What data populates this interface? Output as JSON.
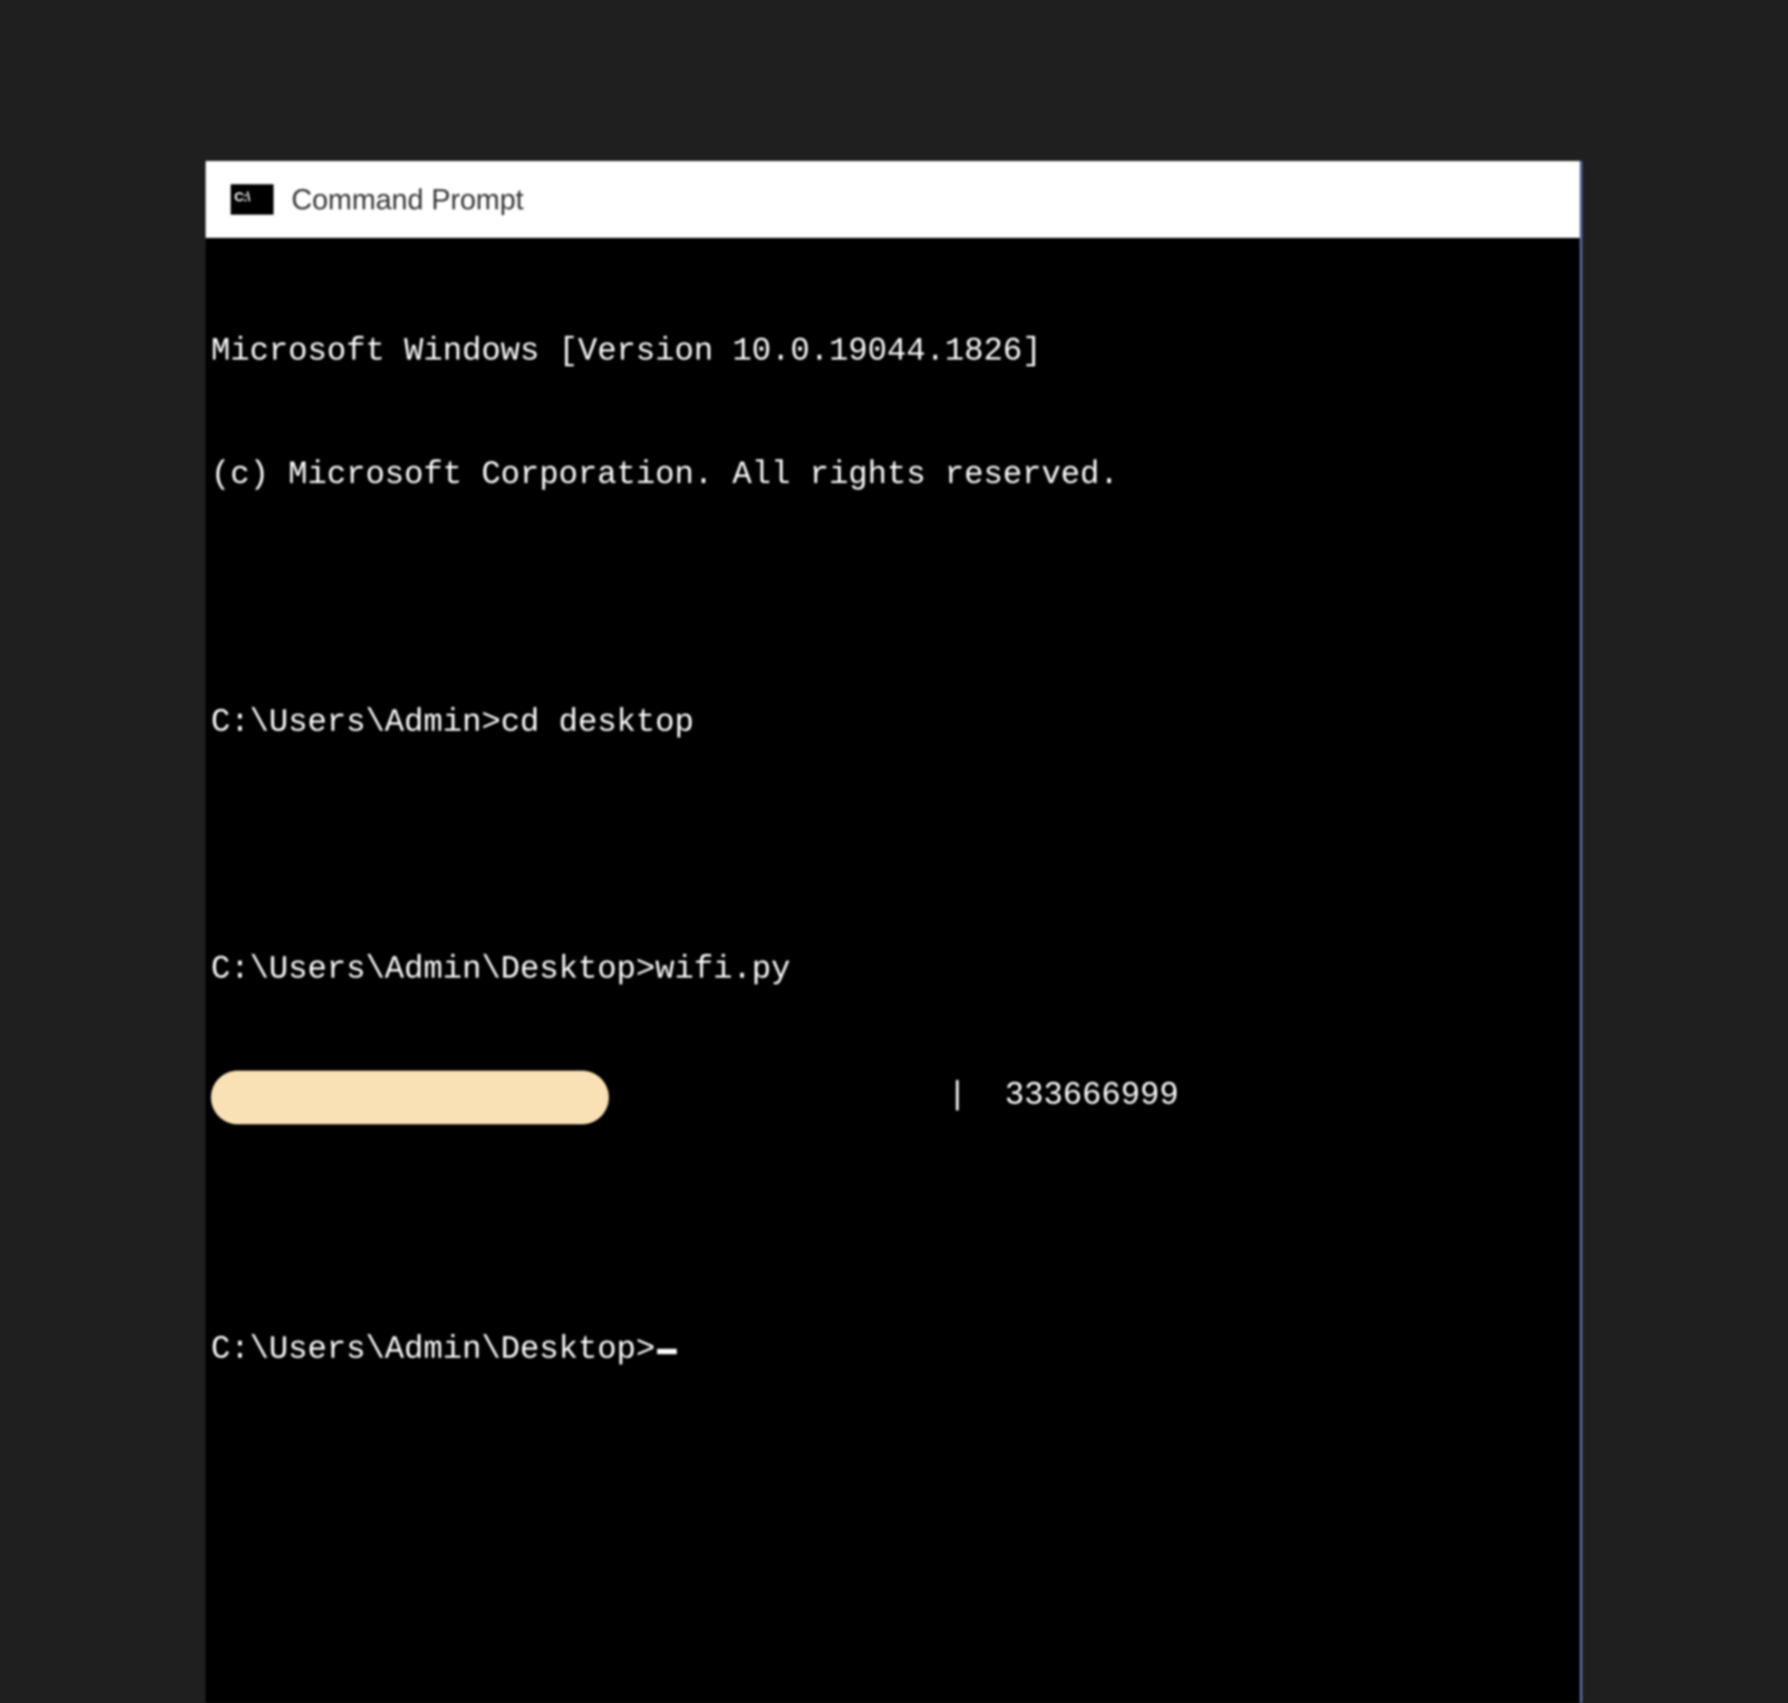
{
  "window": {
    "title": "Command Prompt",
    "icon_text": ""
  },
  "terminal": {
    "banner_line1": "Microsoft Windows [Version 10.0.19044.1826]",
    "banner_line2": "(c) Microsoft Corporation. All rights reserved.",
    "session": [
      {
        "prompt": "C:\\Users\\Admin>",
        "command": "cd desktop"
      },
      {
        "prompt": "C:\\Users\\Admin\\Desktop>",
        "command": "wifi.py",
        "output": {
          "redacted_field": "",
          "separator": "|",
          "value": "333666999"
        }
      },
      {
        "prompt": "C:\\Users\\Admin\\Desktop>",
        "command": ""
      }
    ]
  }
}
